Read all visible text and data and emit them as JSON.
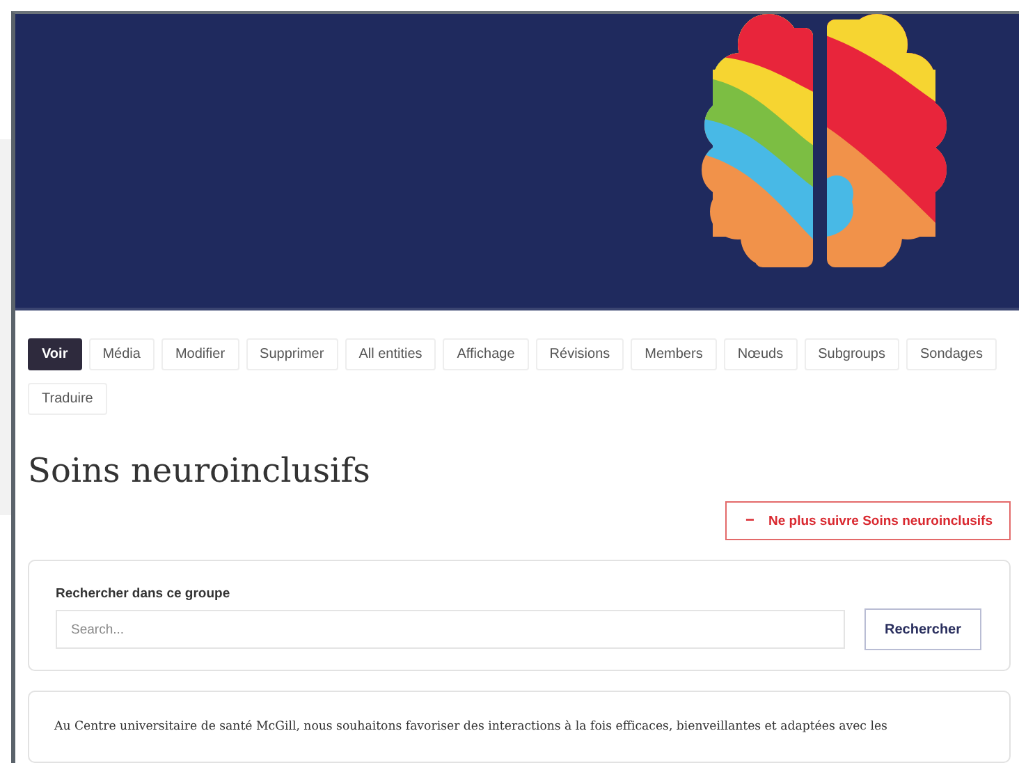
{
  "tabs": [
    {
      "label": "Voir",
      "selected": true
    },
    {
      "label": "Média",
      "selected": false
    },
    {
      "label": "Modifier",
      "selected": false
    },
    {
      "label": "Supprimer",
      "selected": false
    },
    {
      "label": "All entities",
      "selected": false
    },
    {
      "label": "Affichage",
      "selected": false
    },
    {
      "label": "Révisions",
      "selected": false
    },
    {
      "label": "Members",
      "selected": false
    },
    {
      "label": "Nœuds",
      "selected": false
    },
    {
      "label": "Subgroups",
      "selected": false
    },
    {
      "label": "Sondages",
      "selected": false
    },
    {
      "label": "Traduire",
      "selected": false
    }
  ],
  "page_title": "Soins neuroinclusifs",
  "unfollow_button": {
    "icon": "−",
    "label": "Ne plus suivre Soins neuroinclusifs"
  },
  "search": {
    "label": "Rechercher dans ce groupe",
    "placeholder": "Search...",
    "button": "Rechercher"
  },
  "intro": "Au Centre universitaire de santé McGill, nous souhaitons favoriser des interactions à la fois efficaces, bienveillantes et adaptées avec les"
}
